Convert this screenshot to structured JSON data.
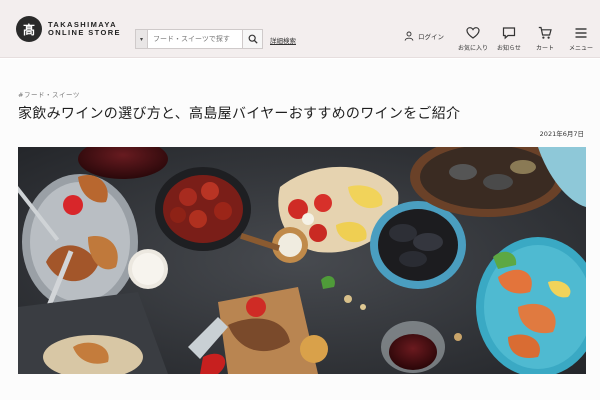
{
  "header": {
    "logo_line1": "TAKASHIMAYA",
    "logo_line2": "ONLINE STORE",
    "logo_mark": "髙",
    "search_category_icon": "caret-down-icon",
    "search_placeholder": "フード・スイーツで探す",
    "search_icon": "search-icon",
    "search_link": "詳細検索",
    "login_label": "ログイン",
    "nav": [
      {
        "icon": "heart-icon",
        "label": "お気に入り"
      },
      {
        "icon": "message-icon",
        "label": "お知らせ"
      },
      {
        "icon": "cart-icon",
        "label": "カート"
      },
      {
        "icon": "menu-icon",
        "label": "メニュー"
      }
    ]
  },
  "article": {
    "breadcrumb": "#フード・スイーツ",
    "title": "家飲みワインの選び方と、高島屋バイヤーおすすめのワインをご紹介",
    "date": "2021年6月7日"
  },
  "colors": {
    "header_bg": "#f3eeee",
    "hero_table": "#2f3236",
    "accent_bowl": "#45b7cc"
  }
}
